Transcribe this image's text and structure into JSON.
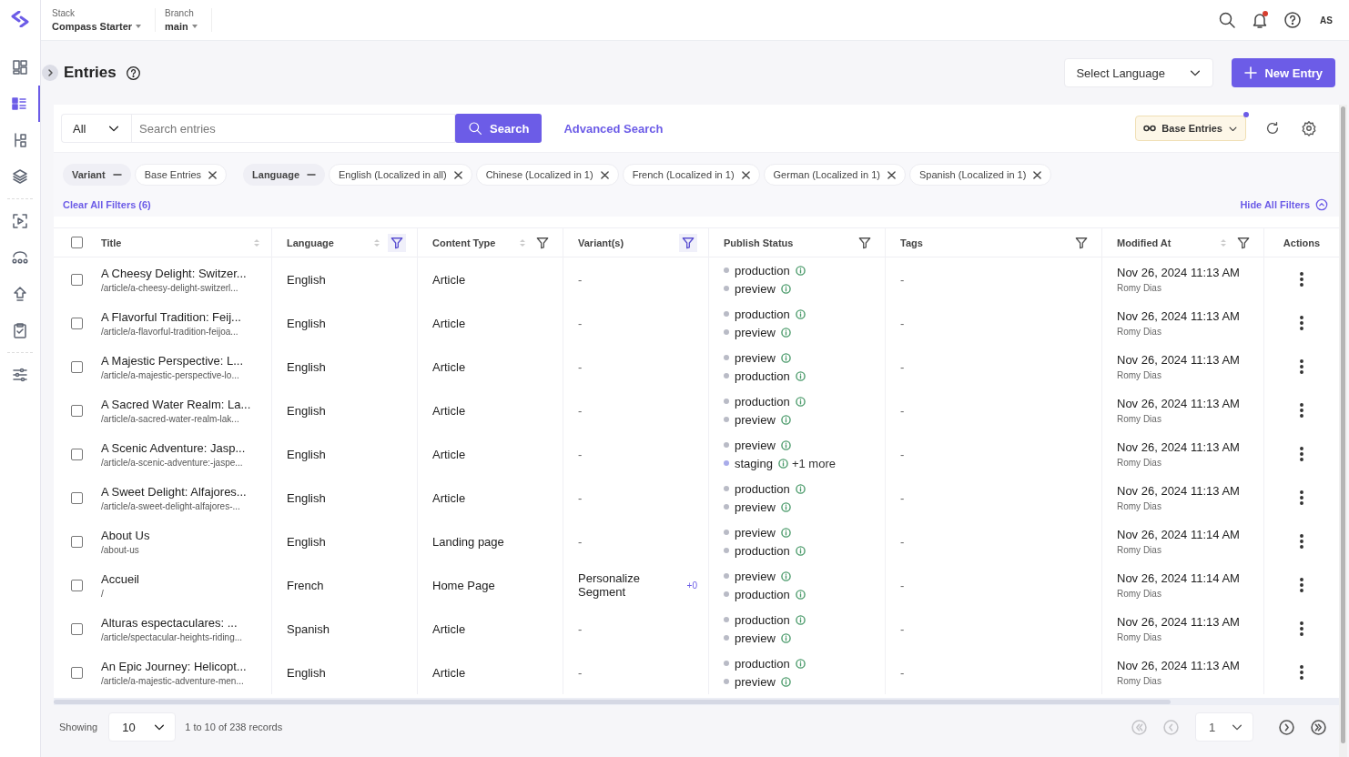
{
  "topbar": {
    "stack": {
      "label": "Stack",
      "value": "Compass Starter"
    },
    "branch": {
      "label": "Branch",
      "value": "main"
    },
    "notifications": {
      "unread": true
    },
    "avatar": "AS"
  },
  "sidebar": {
    "items": [
      {
        "selected": false
      },
      {
        "selected": true
      },
      {
        "selected": false
      },
      {
        "selected": false
      },
      {
        "selected": false
      },
      {
        "selected": false
      },
      {
        "selected": false
      },
      {
        "selected": false
      },
      {
        "selected": false
      }
    ]
  },
  "page": {
    "title": "Entries",
    "language_select": {
      "placeholder": "Select Language"
    },
    "new_button": "New Entry"
  },
  "toolbar": {
    "scope": "All",
    "search": {
      "placeholder": "Search entries"
    },
    "search_button": "Search",
    "advanced_link": "Advanced Search",
    "variant_button": {
      "label": "Base Entries",
      "indicator": true
    }
  },
  "filters": {
    "groups": [
      {
        "label": "Variant",
        "values": [
          "Base Entries"
        ]
      },
      {
        "label": "Language",
        "values": [
          "English (Localized in all)",
          "Chinese (Localized in 1)",
          "French (Localized in 1)",
          "German (Localized in 1)",
          "Spanish (Localized in 1)"
        ]
      }
    ],
    "clear_link": "Clear All Filters (6)",
    "hide_link": "Hide All Filters"
  },
  "table": {
    "select_all": {
      "checked": false
    },
    "columns": [
      {
        "label": "Title",
        "sort": true
      },
      {
        "label": "Language",
        "sort": true,
        "filter_active": true
      },
      {
        "label": "Content Type",
        "sort": true,
        "filter_active": false
      },
      {
        "label": "Variant(s)",
        "filter_active": true
      },
      {
        "label": "Publish Status",
        "filter_active": false
      },
      {
        "label": "Tags",
        "filter_active": false
      },
      {
        "label": "Modified At",
        "sort": true,
        "filter_active": false
      },
      {
        "label": "Actions"
      }
    ],
    "rows": [
      {
        "checked": false,
        "title": "A Cheesy Delight: Switzer...",
        "url": "/article/a-cheesy-delight-switzerl...",
        "language": "English",
        "content_type": "Article",
        "variants": "-",
        "statuses": [
          {
            "name": "production",
            "color": "#b9bbc6"
          },
          {
            "name": "preview",
            "color": "#b9bbc6"
          }
        ],
        "tags": "-",
        "modified": "Nov 26, 2024 11:13 AM",
        "author": "Romy Dias"
      },
      {
        "checked": false,
        "title": "A Flavorful Tradition: Feij...",
        "url": "/article/a-flavorful-tradition-feijoa...",
        "language": "English",
        "content_type": "Article",
        "variants": "-",
        "statuses": [
          {
            "name": "production",
            "color": "#b9bbc6"
          },
          {
            "name": "preview",
            "color": "#b9bbc6"
          }
        ],
        "tags": "-",
        "modified": "Nov 26, 2024 11:13 AM",
        "author": "Romy Dias"
      },
      {
        "checked": false,
        "title": "A Majestic Perspective: L...",
        "url": "/article/a-majestic-perspective-lo...",
        "language": "English",
        "content_type": "Article",
        "variants": "-",
        "statuses": [
          {
            "name": "preview",
            "color": "#b9bbc6"
          },
          {
            "name": "production",
            "color": "#b9bbc6"
          }
        ],
        "tags": "-",
        "modified": "Nov 26, 2024 11:13 AM",
        "author": "Romy Dias"
      },
      {
        "checked": false,
        "title": "A Sacred Water Realm: La...",
        "url": "/article/a-sacred-water-realm-lak...",
        "language": "English",
        "content_type": "Article",
        "variants": "-",
        "statuses": [
          {
            "name": "production",
            "color": "#b9bbc6"
          },
          {
            "name": "preview",
            "color": "#b9bbc6"
          }
        ],
        "tags": "-",
        "modified": "Nov 26, 2024 11:13 AM",
        "author": "Romy Dias"
      },
      {
        "checked": false,
        "title": "A Scenic Adventure: Jasp...",
        "url": "/article/a-scenic-adventure:-jaspe...",
        "language": "English",
        "content_type": "Article",
        "variants": "-",
        "statuses": [
          {
            "name": "preview",
            "color": "#b9bbc6"
          },
          {
            "name": "staging",
            "color": "#a9acea"
          }
        ],
        "more": "+1 more",
        "tags": "-",
        "modified": "Nov 26, 2024 11:13 AM",
        "author": "Romy Dias"
      },
      {
        "checked": false,
        "title": "A Sweet Delight: Alfajores...",
        "url": "/article/a-sweet-delight-alfajores-...",
        "language": "English",
        "content_type": "Article",
        "variants": "-",
        "statuses": [
          {
            "name": "production",
            "color": "#b9bbc6"
          },
          {
            "name": "preview",
            "color": "#b9bbc6"
          }
        ],
        "tags": "-",
        "modified": "Nov 26, 2024 11:13 AM",
        "author": "Romy Dias"
      },
      {
        "checked": false,
        "title": "About Us",
        "url": "/about-us",
        "language": "English",
        "content_type": "Landing page",
        "variants": "-",
        "statuses": [
          {
            "name": "preview",
            "color": "#b9bbc6"
          },
          {
            "name": "production",
            "color": "#b9bbc6"
          }
        ],
        "tags": "-",
        "modified": "Nov 26, 2024 11:14 AM",
        "author": "Romy Dias"
      },
      {
        "checked": false,
        "title": "Accueil",
        "url": "/",
        "language": "French",
        "content_type": "Home Page",
        "variants": "Personalize Segment",
        "variant_count": "+0",
        "statuses": [
          {
            "name": "preview",
            "color": "#b9bbc6"
          },
          {
            "name": "production",
            "color": "#b9bbc6"
          }
        ],
        "tags": "-",
        "modified": "Nov 26, 2024 11:14 AM",
        "author": "Romy Dias"
      },
      {
        "checked": false,
        "title": "Alturas espectaculares: ...",
        "url": "/article/spectacular-heights-riding...",
        "language": "Spanish",
        "content_type": "Article",
        "variants": "-",
        "statuses": [
          {
            "name": "production",
            "color": "#b9bbc6"
          },
          {
            "name": "preview",
            "color": "#b9bbc6"
          }
        ],
        "tags": "-",
        "modified": "Nov 26, 2024 11:13 AM",
        "author": "Romy Dias"
      },
      {
        "checked": false,
        "title": "An Epic Journey: Helicopt...",
        "url": "/article/a-majestic-adventure-men...",
        "language": "English",
        "content_type": "Article",
        "variants": "-",
        "statuses": [
          {
            "name": "production",
            "color": "#b9bbc6"
          },
          {
            "name": "preview",
            "color": "#b9bbc6"
          }
        ],
        "tags": "-",
        "modified": "Nov 26, 2024 11:13 AM",
        "author": "Romy Dias"
      }
    ]
  },
  "footer": {
    "showing_label": "Showing",
    "page_size": "10",
    "records": "1 to 10 of 238 records",
    "page": "1",
    "nav_buttons": [
      {
        "disabled": true
      },
      {
        "disabled": true
      },
      {
        "disabled": false
      },
      {
        "disabled": false
      }
    ]
  }
}
